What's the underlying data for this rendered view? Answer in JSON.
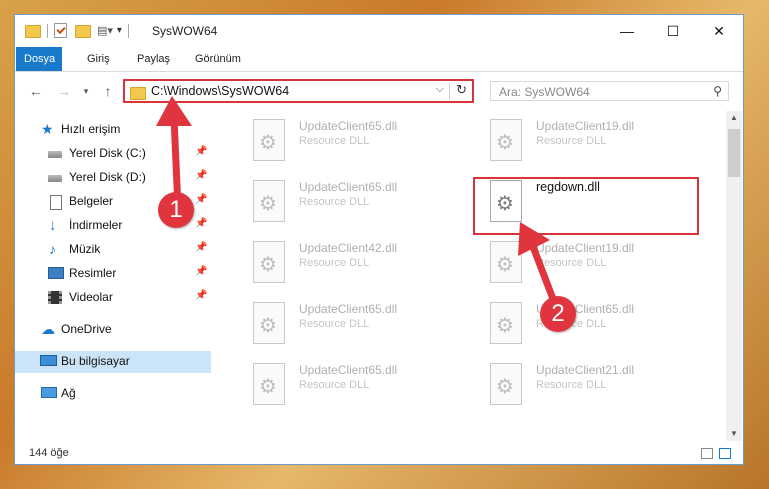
{
  "window": {
    "title": "SysWOW64",
    "controls": {
      "minimize": "—",
      "maximize": "☐",
      "close": "✕"
    }
  },
  "ribbon": {
    "tabs": [
      "Dosya",
      "Giriş",
      "Paylaş",
      "Görünüm"
    ]
  },
  "address": {
    "path": "C:\\Windows\\SysWOW64",
    "search_placeholder": "Ara: SysWOW64"
  },
  "nav": {
    "quick_access": "Hızlı erişim",
    "items": [
      {
        "label": "Yerel Disk (C:)",
        "icon": "drive-icon",
        "pinned": true
      },
      {
        "label": "Yerel Disk (D:)",
        "icon": "drive-icon",
        "pinned": true
      },
      {
        "label": "Belgeler",
        "icon": "documents-icon",
        "pinned": true
      },
      {
        "label": "İndirmeler",
        "icon": "downloads-icon",
        "pinned": true
      },
      {
        "label": "Müzik",
        "icon": "music-icon",
        "pinned": true
      },
      {
        "label": "Resimler",
        "icon": "pictures-icon",
        "pinned": true
      },
      {
        "label": "Videolar",
        "icon": "videos-icon",
        "pinned": true
      }
    ],
    "onedrive": "OneDrive",
    "this_pc": "Bu bilgisayar",
    "network": "Ağ"
  },
  "files": [
    {
      "name": "UpdateClient65.dll",
      "type": "Resource DLL"
    },
    {
      "name": "UpdateClient19.dll",
      "type": "Resource DLL"
    },
    {
      "name": "UpdateClient65.dll",
      "type": "Resource DLL"
    },
    {
      "name": "regdown.dll",
      "type": ""
    },
    {
      "name": "UpdateClient42.dll",
      "type": "Resource DLL"
    },
    {
      "name": "UpdateClient19.dll",
      "type": "Resource DLL"
    },
    {
      "name": "UpdateClient65.dll",
      "type": "Resource DLL"
    },
    {
      "name": "UpdateClient65.dll",
      "type": "Resource DLL"
    },
    {
      "name": "UpdateClient65.dll",
      "type": "Resource DLL"
    },
    {
      "name": "UpdateClient21.dll",
      "type": "Resource DLL"
    }
  ],
  "status": {
    "count": "144 öğe"
  },
  "annotations": {
    "step1": "1",
    "step2": "2"
  },
  "colors": {
    "accent": "#1979ca",
    "highlight": "#d9343c",
    "selected": "#cce4f7"
  }
}
